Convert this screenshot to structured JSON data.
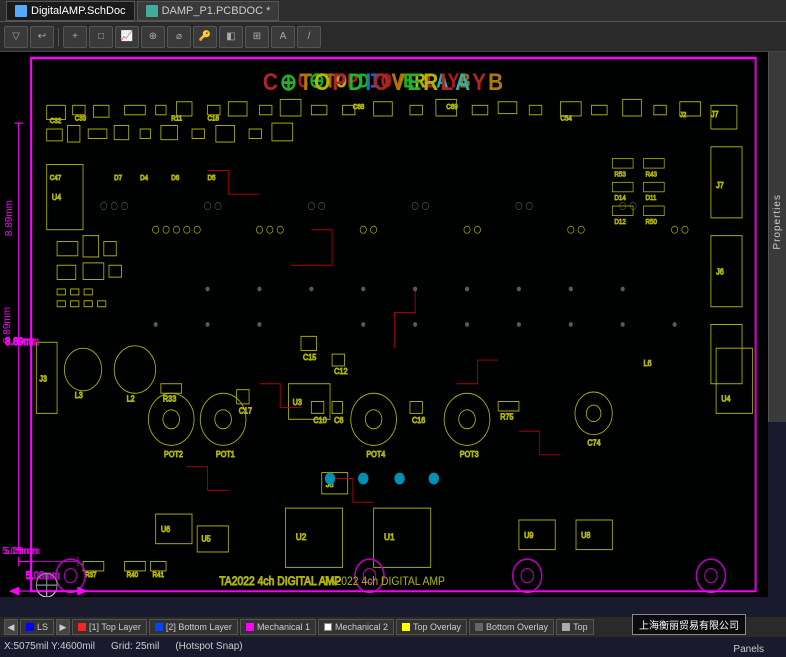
{
  "titlebar": {
    "tabs": [
      {
        "id": "schematic",
        "label": "DigitalAMP.SchDoc",
        "active": false,
        "icon": "sch"
      },
      {
        "id": "pcb",
        "label": "DAMP_P1.PCBDOC *",
        "active": true,
        "icon": "pcb"
      }
    ]
  },
  "toolbar": {
    "buttons": [
      "▲",
      "↩",
      "+",
      "□",
      "📊",
      "⊕",
      "⊙",
      "🔑",
      "◧",
      "⊞",
      "A",
      "/"
    ]
  },
  "pcb": {
    "overlay_title": "C⊕TOPDIOVERLAYB",
    "board_label": "TA2022 4ch DIGITAL AMP",
    "dimension_height": "8.89mm",
    "dimension_width": "5.08mm"
  },
  "layers": [
    {
      "color": "#0000ff",
      "label": "LS",
      "active": true
    },
    {
      "color": "#ff0000",
      "label": "[1] Top Layer",
      "active": false
    },
    {
      "color": "#0000ff",
      "label": "[2] Bottom Layer",
      "active": false
    },
    {
      "color": "#ff00ff",
      "label": "Mechanical 1",
      "active": false
    },
    {
      "color": "#ffffff",
      "label": "Mechanical 2",
      "active": false
    },
    {
      "color": "#ffff00",
      "label": "Top Overlay",
      "active": false
    },
    {
      "color": "#888888",
      "label": "Bottom Overlay",
      "active": false
    },
    {
      "color": "#cccccc",
      "label": "Top",
      "active": false
    }
  ],
  "status": {
    "coordinates": "X:5075mil Y:4600mil",
    "grid": "Grid: 25mil",
    "snap": "(Hotspot Snap)"
  },
  "panels_label": "Panels",
  "properties_label": "Properties",
  "watermark": "上海衡丽贸易有限公司"
}
